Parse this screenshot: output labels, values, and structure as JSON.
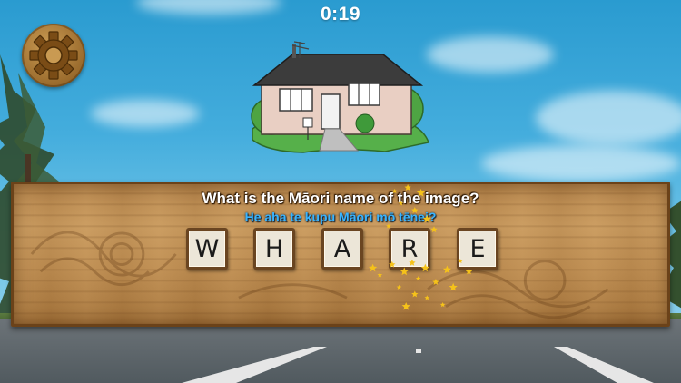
{
  "hud": {
    "timer": "0:19",
    "settings_icon": "gear-icon"
  },
  "question": {
    "english": "What is the Māori name of the image?",
    "maori": "He aha te kupu Māori mō tēnei?"
  },
  "answer": {
    "letters": [
      "W",
      "H",
      "A",
      "R",
      "E"
    ]
  },
  "image_subject": "house-icon",
  "colors": {
    "sky": "#2a9bd0",
    "wood": "#c99a5e",
    "maori_text": "#39b4ff",
    "sparkle": "#f5c21a"
  }
}
